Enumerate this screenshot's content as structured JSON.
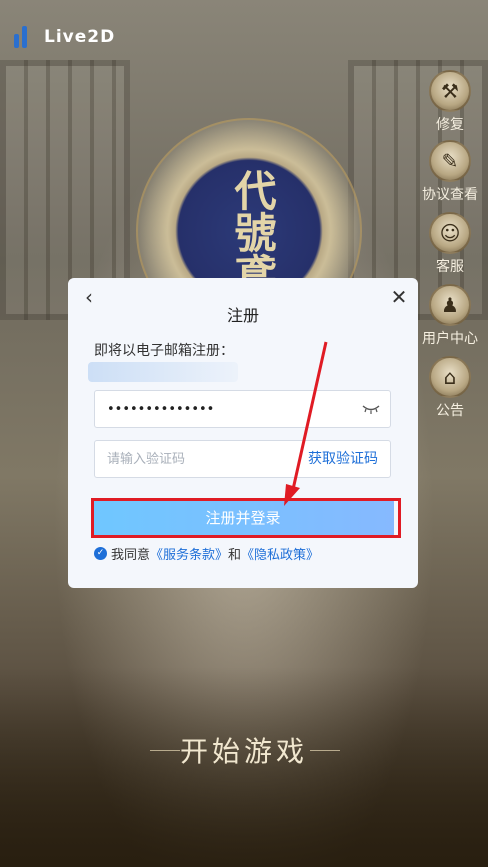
{
  "app": {
    "logo_text": "Live2D"
  },
  "emblem": {
    "text": "代號鳶"
  },
  "side_menu": [
    {
      "label": "修复",
      "icon": "repair-icon",
      "glyph": "⚒"
    },
    {
      "label": "协议查看",
      "icon": "agreement-icon",
      "glyph": "✎"
    },
    {
      "label": "客服",
      "icon": "support-icon",
      "glyph": "☺"
    },
    {
      "label": "用户中心",
      "icon": "user-center-icon",
      "glyph": "♟"
    },
    {
      "label": "公告",
      "icon": "notice-icon",
      "glyph": "⌂"
    }
  ],
  "dialog": {
    "title": "注册",
    "description": "即将以电子邮箱注册：",
    "password_value": "••••••••••••••",
    "code_placeholder": "请输入验证码",
    "get_code_label": "获取验证码",
    "submit_label": "注册并登录",
    "agree_prefix": "我同意",
    "terms_link": "《服务条款》",
    "agree_and": "和",
    "privacy_link": "《隐私政策》"
  },
  "start_label": "开始游戏",
  "colors": {
    "accent": "#1e6fd8",
    "highlight": "#e01b24",
    "button_gradient_start": "#6fc7ff",
    "button_gradient_end": "#86b9ff"
  }
}
